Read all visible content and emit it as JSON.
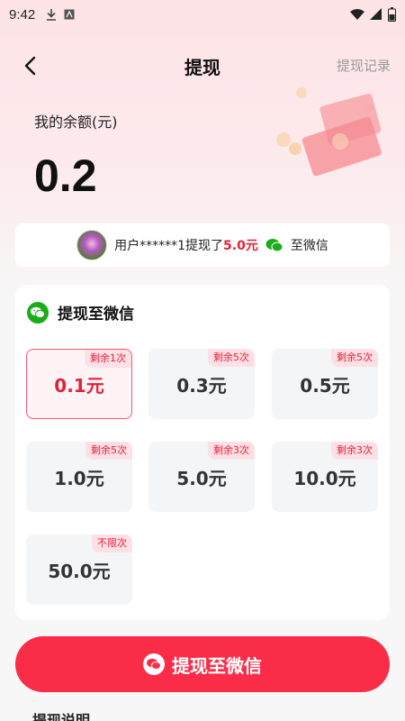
{
  "status_bar": {
    "time": "9:42"
  },
  "nav": {
    "title": "提现",
    "record_link": "提现记录"
  },
  "balance": {
    "label": "我的余额(元)",
    "value": "0.2"
  },
  "notice": {
    "user_text": "用户******1提现了",
    "amount": "5.0元",
    "destination": "至微信"
  },
  "card": {
    "title": "提现至微信",
    "options": [
      {
        "amount": "0.1元",
        "badge": "剩余1次",
        "selected": true
      },
      {
        "amount": "0.3元",
        "badge": "剩余5次",
        "selected": false
      },
      {
        "amount": "0.5元",
        "badge": "剩余5次",
        "selected": false
      },
      {
        "amount": "1.0元",
        "badge": "剩余5次",
        "selected": false
      },
      {
        "amount": "5.0元",
        "badge": "剩余3次",
        "selected": false
      },
      {
        "amount": "10.0元",
        "badge": "剩余3次",
        "selected": false
      },
      {
        "amount": "50.0元",
        "badge": "不限次",
        "selected": false
      }
    ]
  },
  "action": {
    "button_label": "提现至微信"
  },
  "colors": {
    "accent": "#fb2c48",
    "wechat_green": "#1aad19",
    "badge_bg": "#fde0e5"
  },
  "icons": [
    "download-icon",
    "app-icon",
    "wifi-icon",
    "signal-icon",
    "battery-icon",
    "back-arrow-icon",
    "wechat-icon",
    "avatar"
  ],
  "footer": {
    "partial_text": "提现说明"
  }
}
